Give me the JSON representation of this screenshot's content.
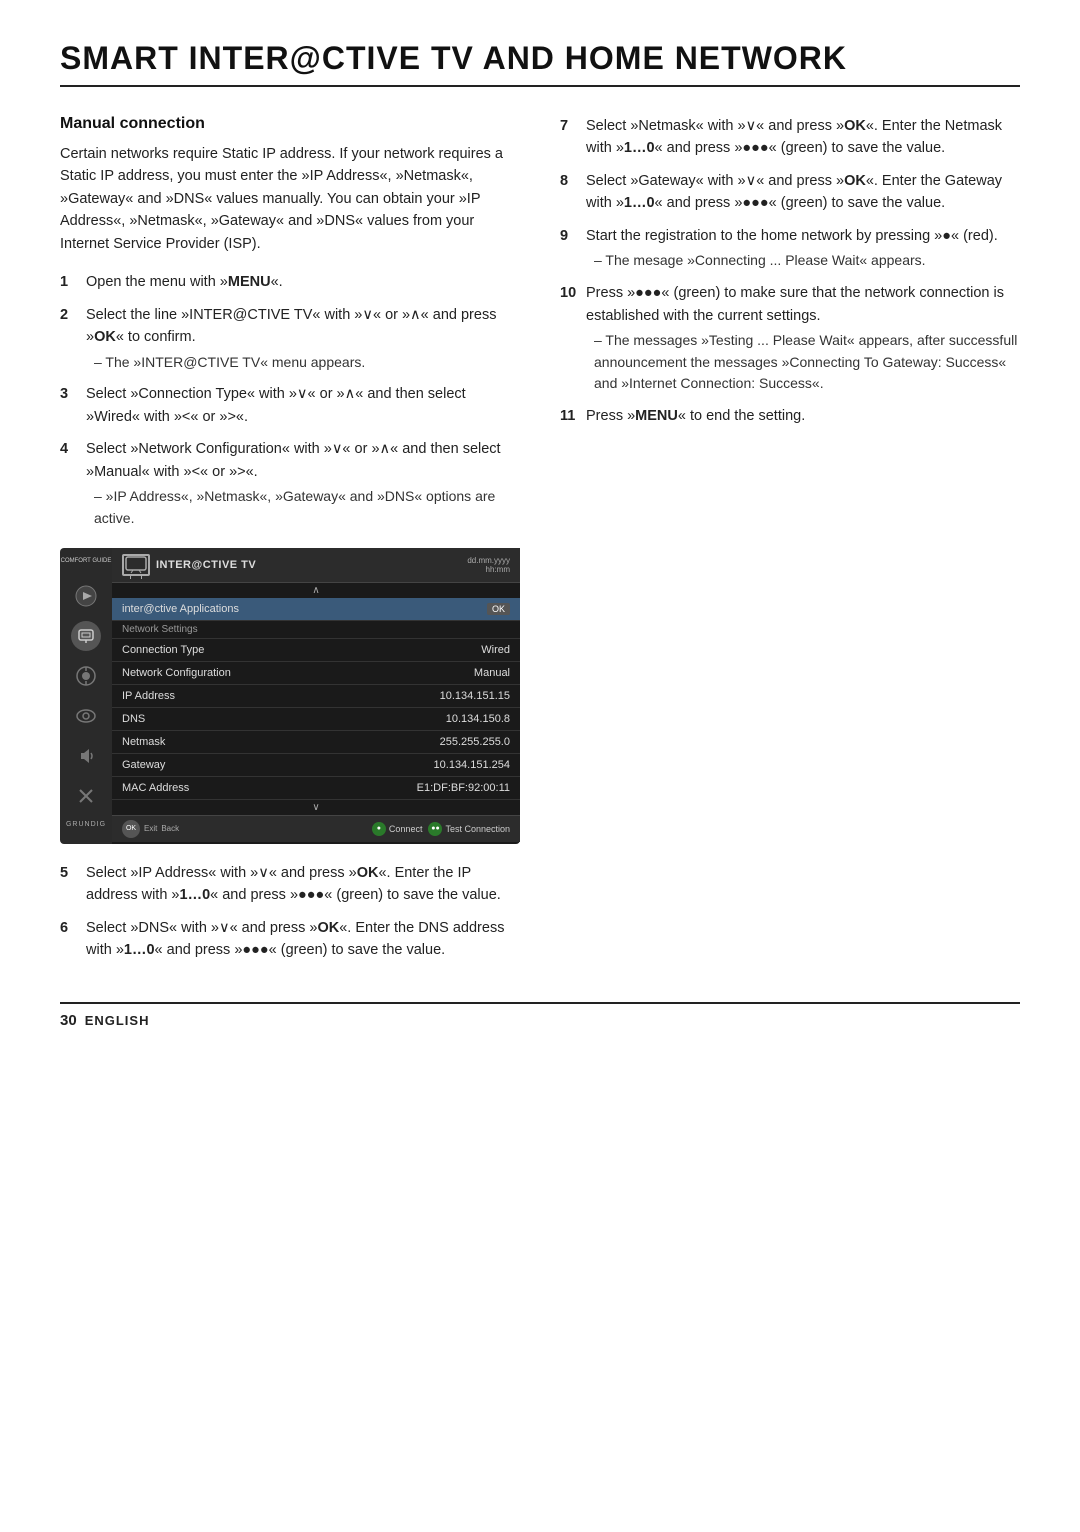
{
  "page": {
    "title": "SMART INTER@CTIVE TV AND HOME NETWORK",
    "section": "Manual connection",
    "footer_page": "30",
    "footer_lang": "ENGLISH"
  },
  "intro": "Certain networks require Static IP address. If your network requires a Static IP address, you must enter the »IP Address«, »Netmask«, »Gateway« and »DNS« values manually. You can obtain your »IP Address«, »Netmask«, »Gateway« and »DNS« values from your Internet Service Provider (ISP).",
  "steps_left": [
    {
      "num": "1",
      "text": "Open the menu with »MENU«.",
      "bold_parts": [
        "MENU"
      ]
    },
    {
      "num": "2",
      "text": "Select the line »INTER@CTIVE TV« with »∨« or »∧« and press »OK« to confirm.",
      "sub": "– The »INTER@CTIVE TV« menu appears.",
      "bold_parts": [
        "OK"
      ]
    },
    {
      "num": "3",
      "text": "Select »Connection Type« with »∨« or »∧« and then select »Wired« with »<« or »>«.",
      "bold_parts": []
    },
    {
      "num": "4",
      "text": "Select »Network Configuration« with »∨« or »∧« and then select »Manual« with »<« or »>«.",
      "sub": "– »IP Address«, »Netmask«, »Gateway« and »DNS« options are active.",
      "bold_parts": []
    }
  ],
  "steps_right": [
    {
      "num": "7",
      "text": "Select »Netmask« with »∨« and press »OK«. Enter the Netmask with »1…0« and press »●●●« (green) to save the value.",
      "bold_parts": [
        "OK",
        "1…0"
      ]
    },
    {
      "num": "8",
      "text": "Select »Gateway« with »∨« and press »OK«. Enter the Gateway with »1…0« and press »●●●« (green) to save the value.",
      "bold_parts": [
        "OK",
        "1…0"
      ]
    },
    {
      "num": "9",
      "text": "Start the registration to the home network by pressing »●« (red).",
      "sub": "– The mesage »Connecting ... Please Wait« appears.",
      "bold_parts": []
    },
    {
      "num": "10",
      "text": "Press »●●●« (green) to make sure that the network connection is established with the current settings.",
      "sub": "– The messages »Testing ... Please Wait« appears, after successfull announcement the messages »Connecting To Gateway: Success« and »Internet Connection: Success«.",
      "bold_parts": []
    },
    {
      "num": "11",
      "text": "Press »MENU« to end the setting.",
      "bold_parts": [
        "MENU"
      ]
    }
  ],
  "steps_bottom": [
    {
      "num": "5",
      "text": "Select »IP Address« with »∨« and press »OK«. Enter the IP address with »1…0« and press »●●●« (green) to save the value.",
      "bold_parts": [
        "OK",
        "1…0"
      ]
    },
    {
      "num": "6",
      "text": "Select »DNS« with »∨« and press »OK«. Enter the DNS address with »1…0« and press »●●●« (green) to save the value.",
      "bold_parts": [
        "OK",
        "1…0"
      ]
    }
  ],
  "tv": {
    "header_title": "INTER@CTIVE TV",
    "time_date": "dd.mm.yyyy",
    "time_hm": "hh:mm",
    "nav_up": "∧",
    "nav_down": "∨",
    "menu_rows": [
      {
        "label": "inter@ctive Applications",
        "value": "OK",
        "type": "highlighted"
      },
      {
        "label": "Network Settings",
        "value": "",
        "type": "section"
      },
      {
        "label": "Connection Type",
        "value": "Wired",
        "type": "normal"
      },
      {
        "label": "Network Configuration",
        "value": "Manual",
        "type": "normal"
      },
      {
        "label": "IP Address",
        "value": "10.134.151.15",
        "type": "normal"
      },
      {
        "label": "DNS",
        "value": "10.134.150.8",
        "type": "normal"
      },
      {
        "label": "Netmask",
        "value": "255.255.255.0",
        "type": "normal"
      },
      {
        "label": "Gateway",
        "value": "10.134.151.254",
        "type": "normal"
      },
      {
        "label": "MAC Address",
        "value": "E1:DF:BF:92:00:11",
        "type": "normal"
      }
    ],
    "footer_connect": "● Connect",
    "footer_test": "●● Test Connection",
    "footer_exit": "Exit",
    "footer_back": "Back",
    "comfort_guide": "COMFORT GUIDE",
    "grundig": "GRUNDIG",
    "sidebar_icons": [
      "●",
      "📡",
      "⚙",
      "👁",
      "🔊",
      "✂"
    ]
  }
}
